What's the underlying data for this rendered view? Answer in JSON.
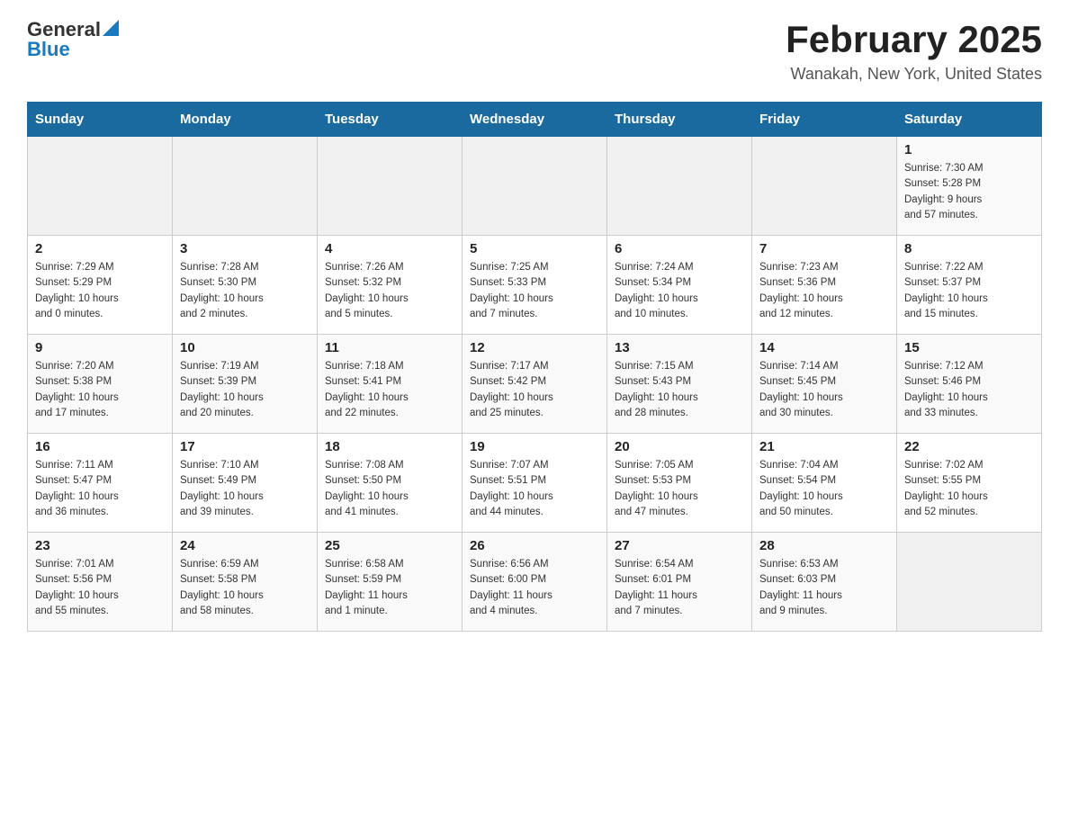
{
  "header": {
    "logo_general": "General",
    "logo_blue": "Blue",
    "month_year": "February 2025",
    "location": "Wanakah, New York, United States"
  },
  "days_of_week": [
    "Sunday",
    "Monday",
    "Tuesday",
    "Wednesday",
    "Thursday",
    "Friday",
    "Saturday"
  ],
  "weeks": [
    [
      {
        "day": "",
        "info": ""
      },
      {
        "day": "",
        "info": ""
      },
      {
        "day": "",
        "info": ""
      },
      {
        "day": "",
        "info": ""
      },
      {
        "day": "",
        "info": ""
      },
      {
        "day": "",
        "info": ""
      },
      {
        "day": "1",
        "info": "Sunrise: 7:30 AM\nSunset: 5:28 PM\nDaylight: 9 hours\nand 57 minutes."
      }
    ],
    [
      {
        "day": "2",
        "info": "Sunrise: 7:29 AM\nSunset: 5:29 PM\nDaylight: 10 hours\nand 0 minutes."
      },
      {
        "day": "3",
        "info": "Sunrise: 7:28 AM\nSunset: 5:30 PM\nDaylight: 10 hours\nand 2 minutes."
      },
      {
        "day": "4",
        "info": "Sunrise: 7:26 AM\nSunset: 5:32 PM\nDaylight: 10 hours\nand 5 minutes."
      },
      {
        "day": "5",
        "info": "Sunrise: 7:25 AM\nSunset: 5:33 PM\nDaylight: 10 hours\nand 7 minutes."
      },
      {
        "day": "6",
        "info": "Sunrise: 7:24 AM\nSunset: 5:34 PM\nDaylight: 10 hours\nand 10 minutes."
      },
      {
        "day": "7",
        "info": "Sunrise: 7:23 AM\nSunset: 5:36 PM\nDaylight: 10 hours\nand 12 minutes."
      },
      {
        "day": "8",
        "info": "Sunrise: 7:22 AM\nSunset: 5:37 PM\nDaylight: 10 hours\nand 15 minutes."
      }
    ],
    [
      {
        "day": "9",
        "info": "Sunrise: 7:20 AM\nSunset: 5:38 PM\nDaylight: 10 hours\nand 17 minutes."
      },
      {
        "day": "10",
        "info": "Sunrise: 7:19 AM\nSunset: 5:39 PM\nDaylight: 10 hours\nand 20 minutes."
      },
      {
        "day": "11",
        "info": "Sunrise: 7:18 AM\nSunset: 5:41 PM\nDaylight: 10 hours\nand 22 minutes."
      },
      {
        "day": "12",
        "info": "Sunrise: 7:17 AM\nSunset: 5:42 PM\nDaylight: 10 hours\nand 25 minutes."
      },
      {
        "day": "13",
        "info": "Sunrise: 7:15 AM\nSunset: 5:43 PM\nDaylight: 10 hours\nand 28 minutes."
      },
      {
        "day": "14",
        "info": "Sunrise: 7:14 AM\nSunset: 5:45 PM\nDaylight: 10 hours\nand 30 minutes."
      },
      {
        "day": "15",
        "info": "Sunrise: 7:12 AM\nSunset: 5:46 PM\nDaylight: 10 hours\nand 33 minutes."
      }
    ],
    [
      {
        "day": "16",
        "info": "Sunrise: 7:11 AM\nSunset: 5:47 PM\nDaylight: 10 hours\nand 36 minutes."
      },
      {
        "day": "17",
        "info": "Sunrise: 7:10 AM\nSunset: 5:49 PM\nDaylight: 10 hours\nand 39 minutes."
      },
      {
        "day": "18",
        "info": "Sunrise: 7:08 AM\nSunset: 5:50 PM\nDaylight: 10 hours\nand 41 minutes."
      },
      {
        "day": "19",
        "info": "Sunrise: 7:07 AM\nSunset: 5:51 PM\nDaylight: 10 hours\nand 44 minutes."
      },
      {
        "day": "20",
        "info": "Sunrise: 7:05 AM\nSunset: 5:53 PM\nDaylight: 10 hours\nand 47 minutes."
      },
      {
        "day": "21",
        "info": "Sunrise: 7:04 AM\nSunset: 5:54 PM\nDaylight: 10 hours\nand 50 minutes."
      },
      {
        "day": "22",
        "info": "Sunrise: 7:02 AM\nSunset: 5:55 PM\nDaylight: 10 hours\nand 52 minutes."
      }
    ],
    [
      {
        "day": "23",
        "info": "Sunrise: 7:01 AM\nSunset: 5:56 PM\nDaylight: 10 hours\nand 55 minutes."
      },
      {
        "day": "24",
        "info": "Sunrise: 6:59 AM\nSunset: 5:58 PM\nDaylight: 10 hours\nand 58 minutes."
      },
      {
        "day": "25",
        "info": "Sunrise: 6:58 AM\nSunset: 5:59 PM\nDaylight: 11 hours\nand 1 minute."
      },
      {
        "day": "26",
        "info": "Sunrise: 6:56 AM\nSunset: 6:00 PM\nDaylight: 11 hours\nand 4 minutes."
      },
      {
        "day": "27",
        "info": "Sunrise: 6:54 AM\nSunset: 6:01 PM\nDaylight: 11 hours\nand 7 minutes."
      },
      {
        "day": "28",
        "info": "Sunrise: 6:53 AM\nSunset: 6:03 PM\nDaylight: 11 hours\nand 9 minutes."
      },
      {
        "day": "",
        "info": ""
      }
    ]
  ]
}
